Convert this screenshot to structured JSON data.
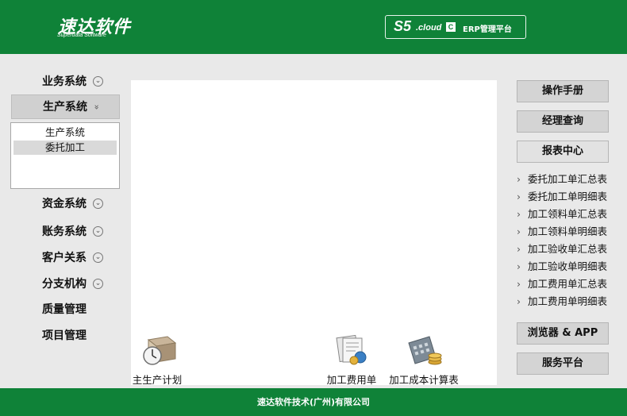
{
  "header": {
    "logo_cn": "速达软件",
    "logo_en": "Superdata Software",
    "badge": {
      "s5": "S5",
      "cloud": ".cloud",
      "c_mark": "C",
      "erp": "ERP管理平台"
    }
  },
  "nav": {
    "items": [
      {
        "label": "业务系统",
        "chevron": "⌄"
      },
      {
        "label": "生产系统",
        "chevron": "»"
      },
      {
        "label": "资金系统",
        "chevron": "⌄"
      },
      {
        "label": "账务系统",
        "chevron": "⌄"
      },
      {
        "label": "客户关系",
        "chevron": "⌄"
      },
      {
        "label": "分支机构",
        "chevron": "⌄"
      },
      {
        "label": "质量管理"
      },
      {
        "label": "项目管理"
      }
    ],
    "sub_items": [
      {
        "label": "生产系统"
      },
      {
        "label": "委托加工"
      }
    ]
  },
  "shortcuts": [
    {
      "label": "主生产计划",
      "icon": "clock-box-icon"
    },
    {
      "label": "加工费用单",
      "icon": "documents-icon"
    },
    {
      "label": "加工成本计算表",
      "icon": "calculator-coins-icon"
    }
  ],
  "right": {
    "manual": "操作手册",
    "manager_query": "经理查询",
    "report_center": "报表中心",
    "reports": [
      "委托加工单汇总表",
      "委托加工单明细表",
      "加工领料单汇总表",
      "加工领料单明细表",
      "加工验收单汇总表",
      "加工验收单明细表",
      "加工费用单汇总表",
      "加工费用单明细表"
    ],
    "browser_app": "浏览器 & APP",
    "service": "服务平台"
  },
  "footer": {
    "text": "速达软件技术(广州)有限公司"
  },
  "colors": {
    "brand_green": "#0f8238",
    "panel_gray": "#e9e9e9"
  }
}
